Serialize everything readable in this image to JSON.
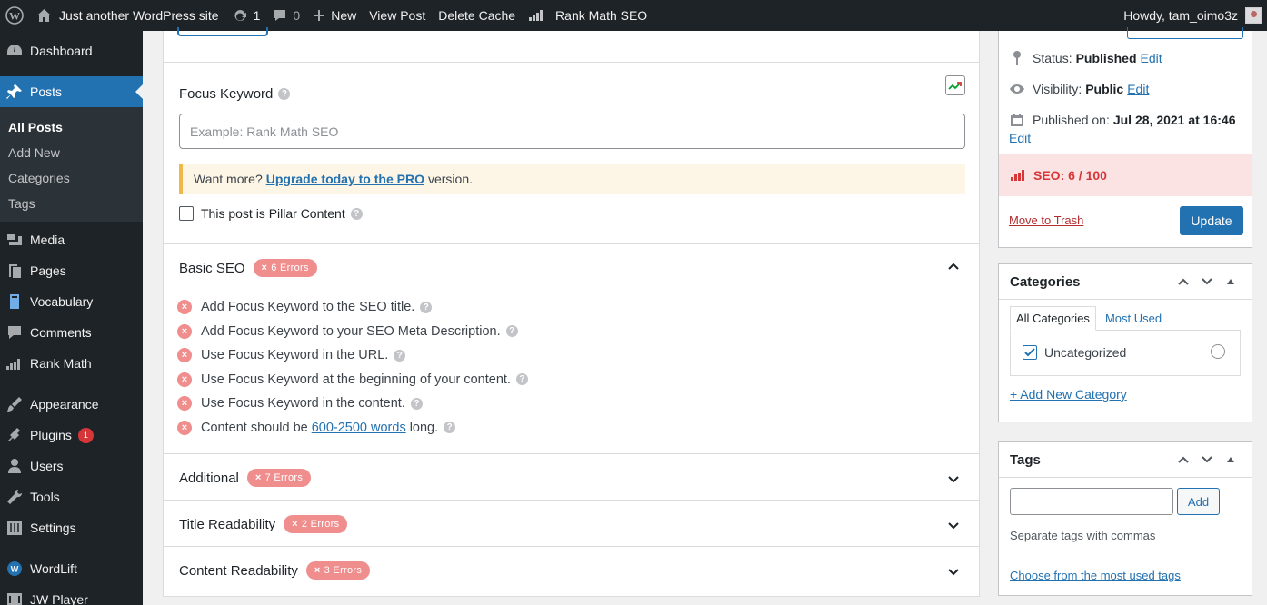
{
  "admin_bar": {
    "site_name": "Just another WordPress site",
    "updates_count": "1",
    "comments_count": "0",
    "new_label": "New",
    "view_post": "View Post",
    "delete_cache": "Delete Cache",
    "rank_math": "Rank Math SEO",
    "howdy": "Howdy, tam_oimo3z"
  },
  "sidebar": {
    "dashboard": "Dashboard",
    "posts": "Posts",
    "sub": [
      "All Posts",
      "Add New",
      "Categories",
      "Tags"
    ],
    "media": "Media",
    "pages": "Pages",
    "vocabulary": "Vocabulary",
    "comments": "Comments",
    "rank_math": "Rank Math",
    "appearance": "Appearance",
    "plugins": "Plugins",
    "plugins_badge": "1",
    "users": "Users",
    "tools": "Tools",
    "settings": "Settings",
    "wordlift": "WordLift",
    "jw_player": "JW Player"
  },
  "main": {
    "focus_keyword_label": "Focus Keyword",
    "focus_keyword_placeholder": "Example: Rank Math SEO",
    "focus_keyword_value": "",
    "notice_prefix": "Want more?",
    "notice_link": "Upgrade today to the PRO",
    "notice_suffix": "version.",
    "pillar_label": "This post is Pillar Content",
    "sections": [
      {
        "title": "Basic SEO",
        "badge": "6 Errors"
      },
      {
        "title": "Additional",
        "badge": "7 Errors"
      },
      {
        "title": "Title Readability",
        "badge": "2 Errors"
      },
      {
        "title": "Content Readability",
        "badge": "3 Errors"
      }
    ],
    "checks": [
      "Add Focus Keyword to the SEO title.",
      "Add Focus Keyword to your SEO Meta Description.",
      "Use Focus Keyword in the URL.",
      "Use Focus Keyword at the beginning of your content.",
      "Use Focus Keyword in the content."
    ],
    "content_length": {
      "prefix": "Content should be",
      "link": "600-2500 words",
      "suffix": "long."
    }
  },
  "publish": {
    "status_label": "Status:",
    "status_value": "Published",
    "visibility_label": "Visibility:",
    "visibility_value": "Public",
    "published_label": "Published on:",
    "published_value": "Jul 28, 2021 at 16:46",
    "edit": "Edit",
    "seo_score": "SEO: 6 / 100",
    "trash": "Move to Trash",
    "update": "Update"
  },
  "categories": {
    "title": "Categories",
    "tab_all": "All Categories",
    "tab_used": "Most Used",
    "item": "Uncategorized",
    "add_new": "+ Add New Category"
  },
  "tags": {
    "title": "Tags",
    "add": "Add",
    "hint": "Separate tags with commas",
    "choose": "Choose from the most used tags"
  },
  "colors": {
    "admin_bg": "#1d2327",
    "accent": "#2271b1",
    "error_badge": "#f08d8d",
    "seo_bad_bg": "#fbe3e4",
    "seo_bad_text": "#d63638"
  }
}
